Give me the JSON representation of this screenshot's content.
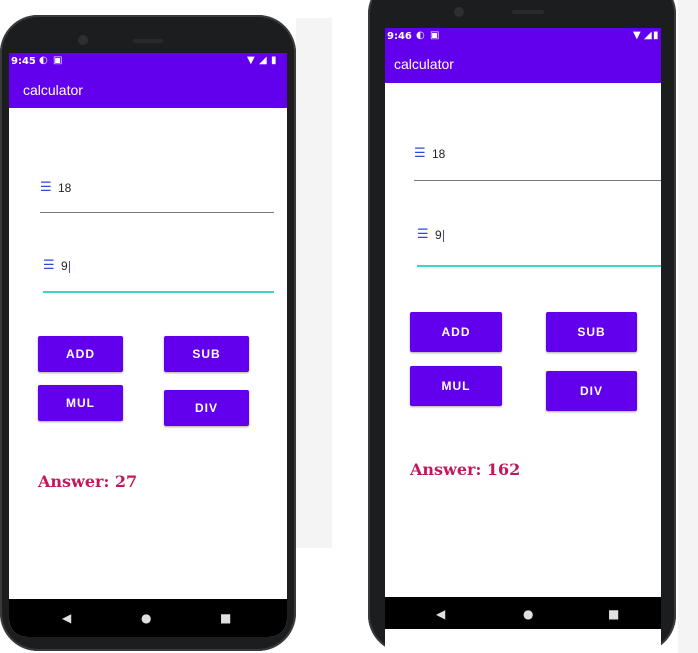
{
  "left_phone": {
    "status": {
      "time": "9:45",
      "icons": [
        "sim-icon",
        "lock-icon",
        "wifi-icon",
        "signal-icon",
        "battery-icon"
      ]
    },
    "app_title": "calculator",
    "input1": {
      "icon": "text-field-icon",
      "value": "18"
    },
    "input2": {
      "icon": "text-field-icon",
      "value": "9"
    },
    "buttons": {
      "add": "ADD",
      "sub": "SUB",
      "mul": "MUL",
      "div": "DIV"
    },
    "answer": "Answer: 27",
    "nav": {
      "back": "◀",
      "home": "●",
      "recents": "■"
    }
  },
  "right_phone": {
    "status": {
      "time": "9:46",
      "icons": [
        "sim-icon",
        "lock-icon",
        "wifi-icon",
        "signal-icon",
        "battery-icon"
      ]
    },
    "app_title": "calculator",
    "input1": {
      "icon": "text-field-icon",
      "value": "18"
    },
    "input2": {
      "icon": "text-field-icon",
      "value": "9"
    },
    "buttons": {
      "add": "ADD",
      "sub": "SUB",
      "mul": "MUL",
      "div": "DIV"
    },
    "answer": "Answer: 162",
    "nav": {
      "back": "◀",
      "home": "●",
      "recents": "■"
    }
  },
  "colors": {
    "primary": "#6200ee",
    "answer": "#c2185b",
    "focus_line": "#3fd6c2",
    "field_icon": "#2a4bd4"
  }
}
